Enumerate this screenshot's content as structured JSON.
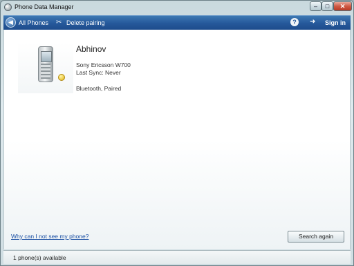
{
  "window": {
    "title": "Phone Data Manager",
    "minimize_glyph": "–",
    "maximize_glyph": "□",
    "close_glyph": "✕"
  },
  "toolbar": {
    "back_glyph": "◀",
    "all_phones_label": "All Phones",
    "delete_glyph": "✂",
    "delete_pairing_label": "Delete pairing",
    "help_glyph": "?",
    "signin_glyph": "➜",
    "signin_label": "Sign in"
  },
  "device": {
    "name": "Abhinov",
    "model": "Sony Ericsson W700",
    "last_sync": "Last Sync: Never",
    "connection": "Bluetooth, Paired"
  },
  "footer": {
    "help_link": "Why can I not see my phone?",
    "search_again": "Search again"
  },
  "statusbar": {
    "count": "1 phone(s) available"
  },
  "colors": {
    "toolbar": "#25589a",
    "link": "#1a4fa3",
    "badge": "#e3b312"
  }
}
